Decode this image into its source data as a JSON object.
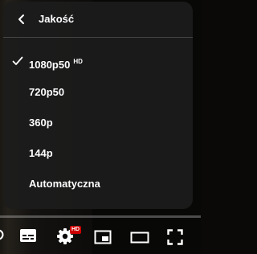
{
  "quality_menu": {
    "title": "Jakość",
    "selected_index": 0,
    "items": [
      {
        "label": "1080p50",
        "badge": "HD"
      },
      {
        "label": "720p50",
        "badge": ""
      },
      {
        "label": "360p",
        "badge": ""
      },
      {
        "label": "144p",
        "badge": ""
      },
      {
        "label": "Automatyczna",
        "badge": ""
      }
    ]
  },
  "controls": {
    "settings_badge": "HD"
  },
  "colors": {
    "menu_bg": "#1c1c1c",
    "text": "#ffffff",
    "badge_red": "#cc0000"
  },
  "icons": [
    "chevron-left-icon",
    "checkmark-icon",
    "subtitles-icon",
    "settings-gear-icon",
    "miniplayer-icon",
    "theater-mode-icon",
    "fullscreen-icon"
  ]
}
